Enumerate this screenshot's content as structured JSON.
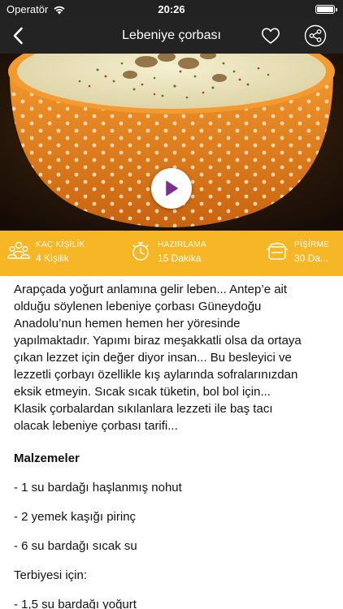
{
  "status_bar": {
    "carrier": "Operatör",
    "time": "20:26",
    "icons": [
      "wifi-icon",
      "battery-icon"
    ]
  },
  "nav": {
    "title": "Lebeniye çorbası",
    "icons": [
      "back-chevron-icon",
      "heart-icon",
      "share-icon"
    ]
  },
  "hero": {
    "icon": "play-icon"
  },
  "info": {
    "servings": {
      "label": "KAÇ KİŞİLİK",
      "value": "4 Kişilik",
      "icon": "people-icon"
    },
    "prep": {
      "label": "HAZIRLAMA",
      "value": "15 Dakika",
      "icon": "stopwatch-icon"
    },
    "cook": {
      "label": "PİŞİRME",
      "value": "30 Da...",
      "icon": "pot-icon"
    }
  },
  "content": {
    "description_lines": [
      "Arapçada yoğurt anlamına gelir leben...  Antep’e ait",
      "olduğu söylenen lebeniye çorbası Güneydoğu",
      "Anadolu’nun hemen hemen her yöresinde",
      "yapılmaktadır. Yapımı biraz meşakkatli olsa da ortaya",
      "çıkan lezzet için değer diyor insan... Bu besleyici ve",
      "lezzetli çorbayı özellikle kış aylarında sofralarınızdan",
      "eksik etmeyin. Sıcak sıcak tüketin, bol bol için...",
      "Klasik çorbalardan sıkılanlara lezzeti ile baş tacı",
      "olacak lebeniye çorbası tarifi..."
    ],
    "ingredients_title": "Malzemeler",
    "ingredients": [
      "- 1 su bardağı haşlanmış nohut",
      "- 2 yemek kaşığı pirinç",
      "- 6 su bardağı sıcak su"
    ],
    "sauce_title": "Terbiyesi için:",
    "partial_line": "- 1,5 su bardağı yoğurt"
  },
  "colors": {
    "accent": "#f6b626",
    "navbar": "#232323",
    "play_icon": "#7b2f8c"
  }
}
